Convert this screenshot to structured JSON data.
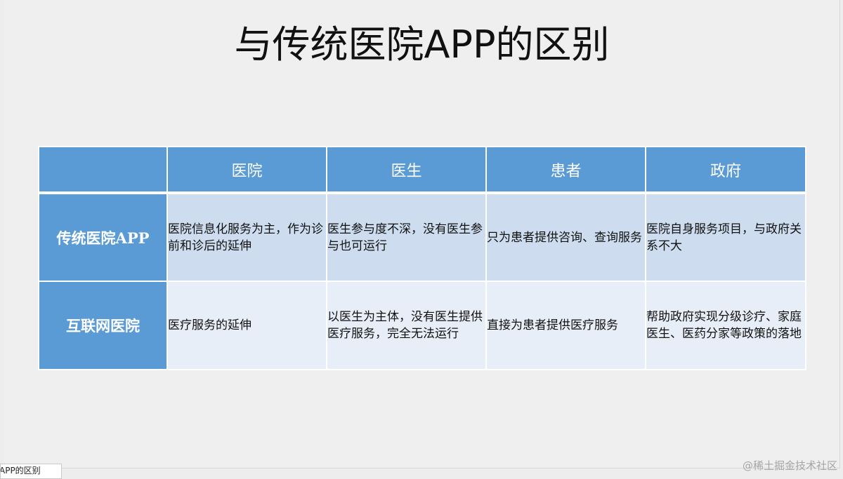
{
  "slide": {
    "title": "与传统医院APP的区别"
  },
  "table": {
    "columns": [
      "",
      "医院",
      "医生",
      "患者",
      "政府"
    ],
    "rows": [
      {
        "label": "传统医院APP",
        "cells": [
          "医院信息化服务为主，作为诊前和诊后的延伸",
          "医生参与度不深，没有医生参与也可运行",
          "只为患者提供咨询、查询服务",
          "医院自身服务项目，与政府关系不大"
        ]
      },
      {
        "label": "互联网医院",
        "cells": [
          "医疗服务的延伸",
          "以医生为主体，没有医生提供医疗服务，完全无法运行",
          "直接为患者提供医疗服务",
          "帮助政府实现分级诊疗、家庭医生、医药分家等政策的落地"
        ]
      }
    ]
  },
  "footer": {
    "tab_label": "APP的区别",
    "watermark": "@稀土掘金技术社区"
  }
}
